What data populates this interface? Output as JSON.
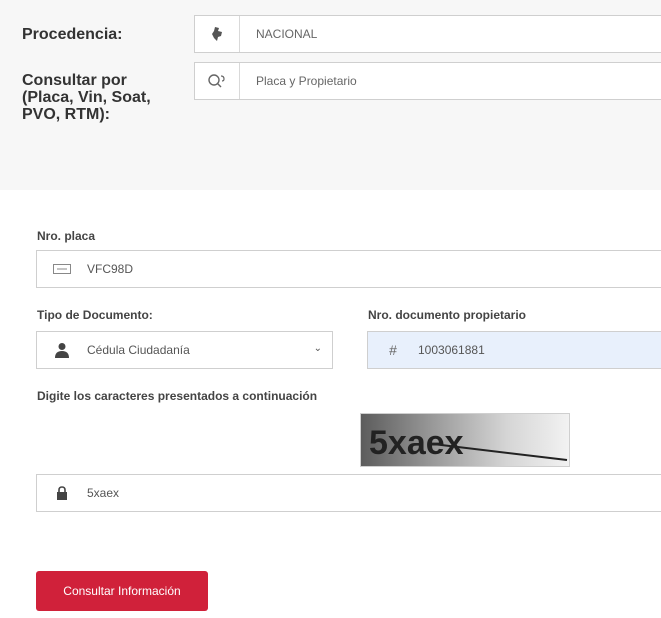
{
  "top": {
    "procedencia_label": "Procedencia:",
    "procedencia_value": "NACIONAL",
    "consultar_label": "Consultar por (Placa, Vin, Soat, PVO, RTM):",
    "consultar_value": "Placa y Propietario"
  },
  "form": {
    "placa_label": "Nro. placa",
    "placa_value": "VFC98D",
    "tipo_doc_label": "Tipo de Documento:",
    "tipo_doc_value": "Cédula Ciudadanía",
    "nro_doc_label": "Nro. documento propietario",
    "nro_doc_value": "1003061881",
    "captcha_label": "Digite los caracteres presentados a continuación",
    "captcha_text": "5xaex",
    "captcha_value": "5xaex",
    "submit_label": "Consultar Información"
  },
  "icons": {
    "procedencia": "colombia-map-icon",
    "consultar": "search-icon",
    "placa": "license-plate-icon",
    "tipo_doc": "user-icon",
    "nro_doc": "hash-icon",
    "captcha_input": "lock-icon",
    "select_caret": "chevron-down-icon"
  },
  "colors": {
    "button": "#d0213a",
    "highlight_input": "#e8f0fc",
    "top_panel": "#f7f7f7"
  }
}
